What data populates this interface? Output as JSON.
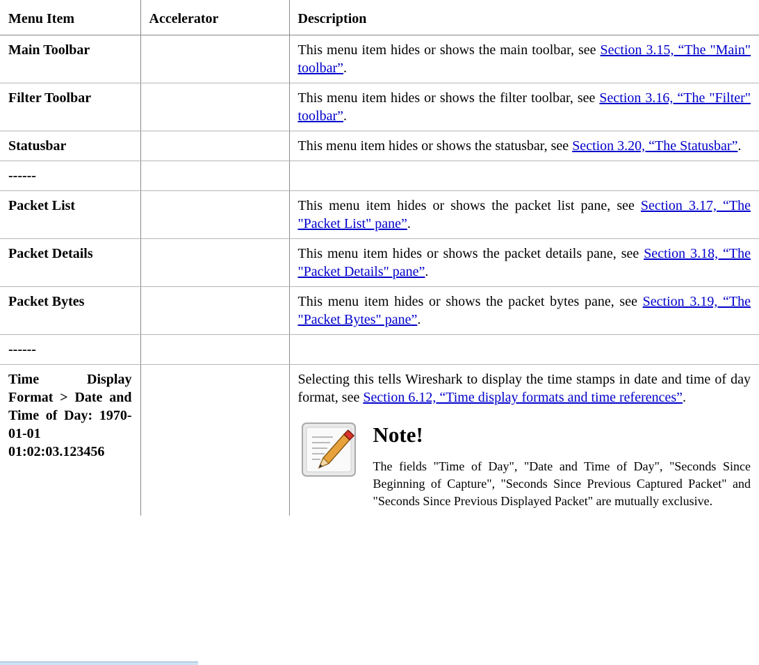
{
  "table": {
    "headers": [
      "Menu Item",
      "Accelerator",
      "Description"
    ],
    "rows": [
      {
        "item": "Main Toolbar",
        "accelerator": "",
        "desc_pre": "This menu item hides or shows the main toolbar, see ",
        "desc_link": "Section 3.15, “The \"Main\" toolbar”",
        "desc_post": "."
      },
      {
        "item": "Filter Toolbar",
        "accelerator": "",
        "desc_pre": "This menu item hides or shows the filter toolbar, see ",
        "desc_link": "Section 3.16, “The \"Filter\" toolbar”",
        "desc_post": "."
      },
      {
        "item": "Statusbar",
        "accelerator": "",
        "desc_pre": "This menu item hides or shows the statusbar, see ",
        "desc_link": "Section 3.20, “The Statusbar”",
        "desc_post": "."
      },
      {
        "item": "------",
        "accelerator": "",
        "desc_pre": "",
        "desc_link": "",
        "desc_post": ""
      },
      {
        "item": "Packet List",
        "accelerator": "",
        "desc_pre": "This menu item hides or shows the packet list pane, see ",
        "desc_link": "Section 3.17, “The \"Packet List\" pane”",
        "desc_post": "."
      },
      {
        "item": "Packet Details",
        "accelerator": "",
        "desc_pre": "This menu item hides or shows the packet details pane, see ",
        "desc_link": "Section 3.18, “The \"Packet Details\" pane”",
        "desc_post": "."
      },
      {
        "item": "Packet Bytes",
        "accelerator": "",
        "desc_pre": "This menu item hides or shows the packet bytes pane, see ",
        "desc_link": "Section 3.19, “The \"Packet Bytes\" pane”",
        "desc_post": "."
      },
      {
        "item": "------",
        "accelerator": "",
        "desc_pre": "",
        "desc_link": "",
        "desc_post": ""
      },
      {
        "item": "Time Display Format > Date and Time of Day: 1970-01-01 01:02:03.123456",
        "accelerator": "",
        "desc_pre": "Selecting this tells Wireshark to display the time stamps in date and time of day format, see ",
        "desc_link": "Section 6.12, “Time display formats and time references”",
        "desc_post": "."
      }
    ]
  },
  "note": {
    "icon": "pencil-note-icon",
    "title": "Note!",
    "text": "The fields \"Time of Day\", \"Date and Time of Day\", \"Seconds Since Beginning of Capture\", \"Seconds Since Previous Captured Packet\" and \"Seconds Since Previous Displayed Packet\" are mutually exclusive."
  },
  "colors": {
    "link": "#0000cc",
    "rule": "#888888"
  }
}
